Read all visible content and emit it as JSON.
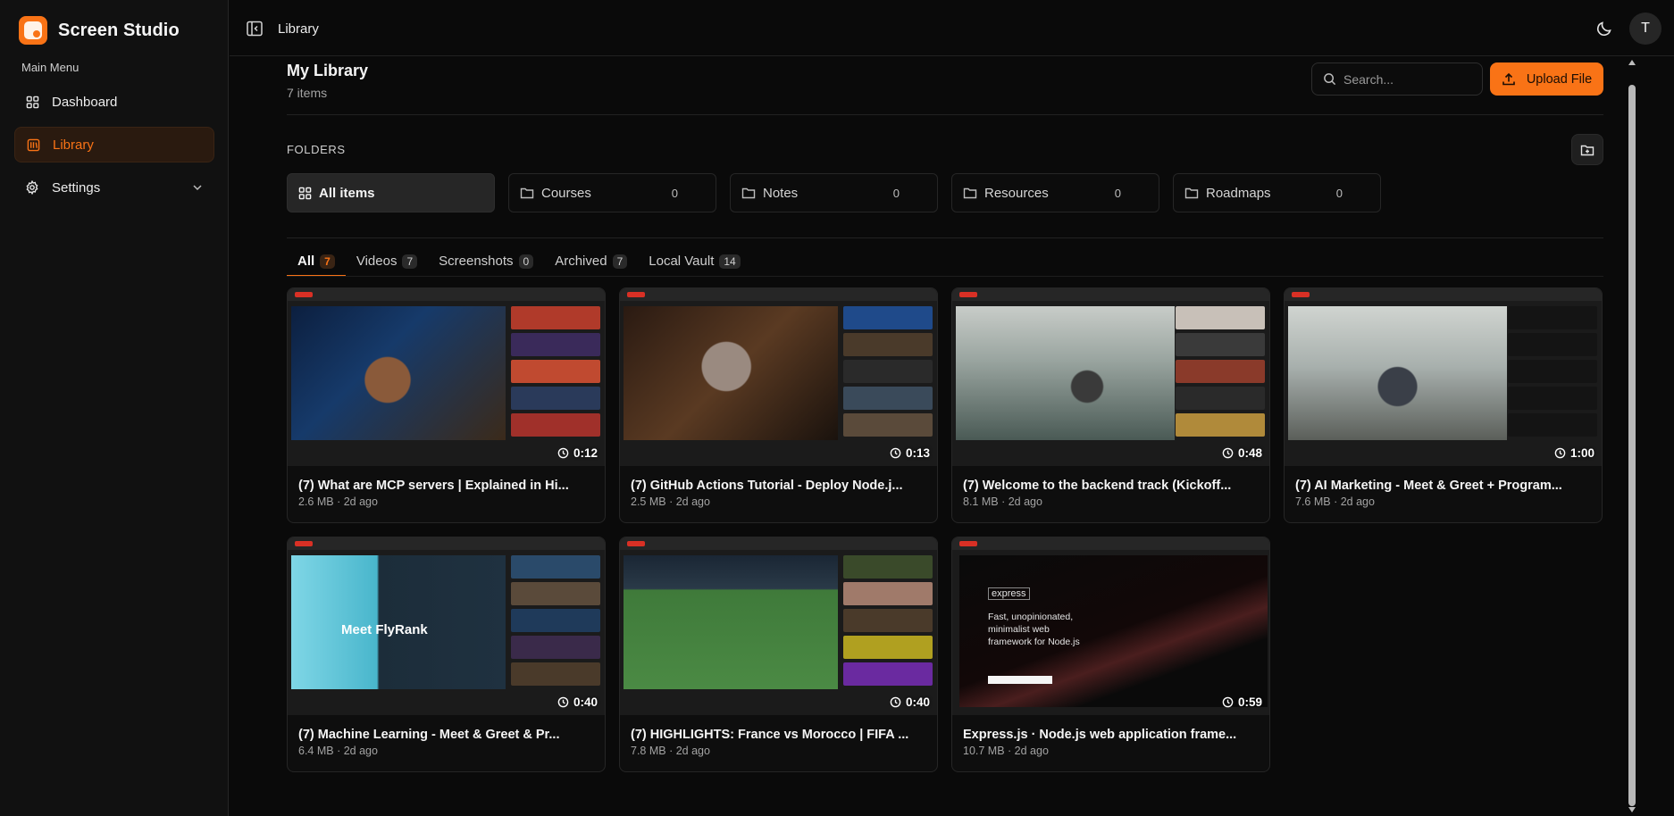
{
  "app": {
    "name": "Screen Studio"
  },
  "sidebar": {
    "menu_label": "Main Menu",
    "items": [
      {
        "label": "Dashboard",
        "icon": "grid-icon"
      },
      {
        "label": "Library",
        "icon": "library-icon",
        "active": true
      },
      {
        "label": "Settings",
        "icon": "gear-icon",
        "expandable": true
      }
    ]
  },
  "topbar": {
    "breadcrumb": "Library",
    "avatar_initial": "T"
  },
  "header": {
    "title": "My Library",
    "count": "7 items",
    "search_placeholder": "Search...",
    "upload_label": "Upload File"
  },
  "folders": {
    "label": "FOLDERS",
    "items": [
      {
        "label": "All items",
        "count": "",
        "active": true
      },
      {
        "label": "Courses",
        "count": "0"
      },
      {
        "label": "Notes",
        "count": "0"
      },
      {
        "label": "Resources",
        "count": "0"
      },
      {
        "label": "Roadmaps",
        "count": "0"
      }
    ]
  },
  "tabs": [
    {
      "label": "All",
      "count": "7",
      "active": true
    },
    {
      "label": "Videos",
      "count": "7"
    },
    {
      "label": "Screenshots",
      "count": "0"
    },
    {
      "label": "Archived",
      "count": "7"
    },
    {
      "label": "Local Vault",
      "count": "14"
    }
  ],
  "media": [
    {
      "title": "(7) What are MCP servers | Explained in Hi...",
      "meta": "2.6 MB · 2d ago",
      "duration": "0:12"
    },
    {
      "title": "(7) GitHub Actions Tutorial - Deploy Node.j...",
      "meta": "2.5 MB · 2d ago",
      "duration": "0:13"
    },
    {
      "title": "(7) Welcome to the backend track (Kickoff...",
      "meta": "8.1 MB · 2d ago",
      "duration": "0:48"
    },
    {
      "title": "(7) AI Marketing - Meet & Greet + Program...",
      "meta": "7.6 MB · 2d ago",
      "duration": "1:00"
    },
    {
      "title": "(7) Machine Learning - Meet & Greet & Pr...",
      "meta": "6.4 MB · 2d ago",
      "duration": "0:40",
      "thumb_title": "Meet FlyRank"
    },
    {
      "title": "(7) HIGHLIGHTS: France vs Morocco | FIFA ...",
      "meta": "7.8 MB · 2d ago",
      "duration": "0:40"
    },
    {
      "title": "Express.js · Node.js web application frame...",
      "meta": "10.7 MB · 2d ago",
      "duration": "0:59",
      "thumb_logo": "express",
      "thumb_text": "Fast, unopinionated, minimalist web framework for Node.js"
    }
  ],
  "colors": {
    "accent": "#f97316",
    "background": "#0a0a0a",
    "sidebar": "#111111"
  }
}
